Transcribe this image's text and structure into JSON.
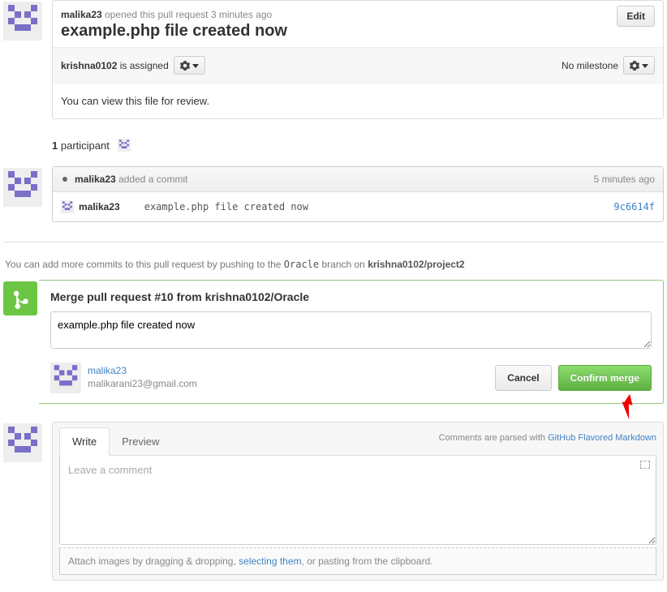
{
  "pr": {
    "opener": "malika23",
    "opened_text": "opened this pull request 3 minutes ago",
    "title": "example.php file created now",
    "edit_label": "Edit",
    "assignee": "krishna0102",
    "assigned_text": "is assigned",
    "milestone_text": "No milestone",
    "description": "You can view this file for review."
  },
  "participants": {
    "count": "1",
    "label": "participant"
  },
  "commit": {
    "author": "malika23",
    "action": "added a commit",
    "when": "5 minutes ago",
    "row_author": "malika23",
    "message": "example.php file created now",
    "sha": "9c6614f"
  },
  "push_hint": {
    "prefix": "You can add more commits to this pull request by pushing to the",
    "branch": "Oracle",
    "mid": "branch on",
    "repo": "krishna0102/project2"
  },
  "merge": {
    "title": "Merge pull request #10 from krishna0102/Oracle",
    "message": "example.php file created now",
    "user": "malika23",
    "email": "malikarani23@gmail.com",
    "cancel": "Cancel",
    "confirm": "Confirm merge"
  },
  "compose": {
    "tab_write": "Write",
    "tab_preview": "Preview",
    "parsed_hint": "Comments are parsed with",
    "parsed_link": "GitHub Flavored Markdown",
    "placeholder": "Leave a comment",
    "attach_prefix": "Attach images by dragging & dropping,",
    "attach_link": "selecting them",
    "attach_suffix": ", or pasting from the clipboard."
  }
}
